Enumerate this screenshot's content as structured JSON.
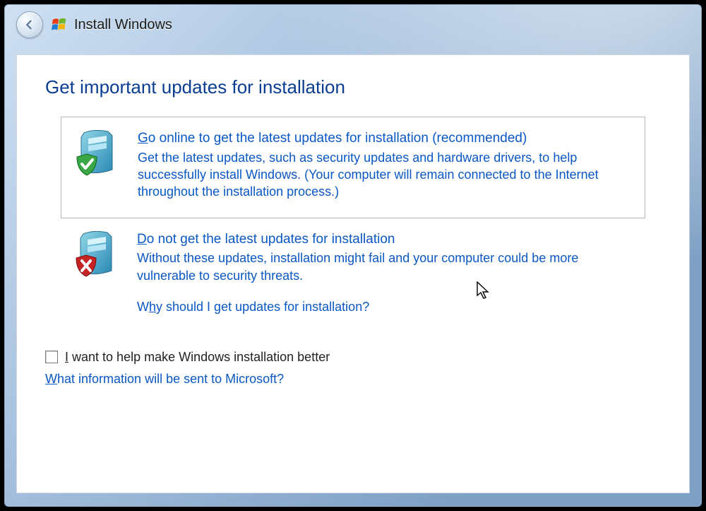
{
  "title": "Install Windows",
  "heading": "Get important updates for installation",
  "option1": {
    "title_pre": "G",
    "title_rest": "o online to get the latest updates for installation (recommended)",
    "desc": "Get the latest updates, such as security updates and hardware drivers, to help successfully install Windows. (Your computer will remain connected to the Internet throughout the installation process.)"
  },
  "option2": {
    "title_pre": "D",
    "title_rest": "o not get the latest updates for installation",
    "desc": "Without these updates, installation might fail and your computer could be more vulnerable to security threats."
  },
  "why_link": {
    "pre": "W",
    "mid": "h",
    "rest": "y should I get updates for installation?"
  },
  "help_cb": {
    "pre": "I",
    "rest": " want to help make Windows installation better"
  },
  "sent_link": {
    "pre": "W",
    "rest": "hat information will be sent to Microsoft?"
  }
}
